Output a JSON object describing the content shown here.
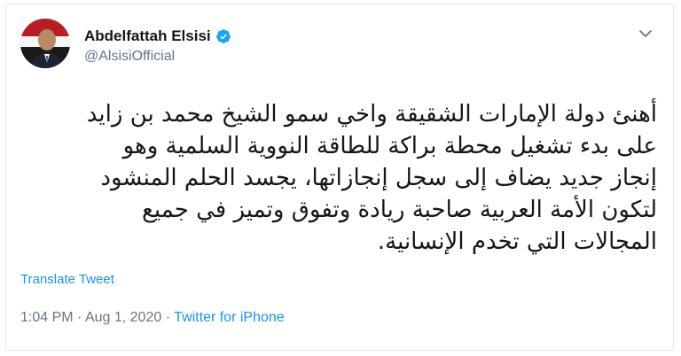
{
  "user": {
    "display_name": "Abdelfattah Elsisi",
    "handle": "@AlsisiOfficial",
    "verified_icon": "verified-badge-icon"
  },
  "tweet": {
    "text": "أهنئ دولة الإمارات الشقيقة واخي سمو الشيخ محمد بن زايد\nعلى بدء تشغيل محطة براكة للطاقة النووية السلمية وهو\nإنجاز جديد يضاف إلى سجل إنجازاتها، يجسد الحلم المنشود\nلتكون الأمة العربية صاحبة ريادة وتفوق وتميز في جميع\nالمجالات التي تخدم الإنسانية.",
    "translate_label": "Translate Tweet",
    "time": "1:04 PM",
    "separator": "·",
    "date": "Aug 1, 2020",
    "source": "Twitter for iPhone"
  },
  "colors": {
    "accent": "#1b95e0",
    "verified": "#1da1f2",
    "secondary_text": "#657786"
  }
}
